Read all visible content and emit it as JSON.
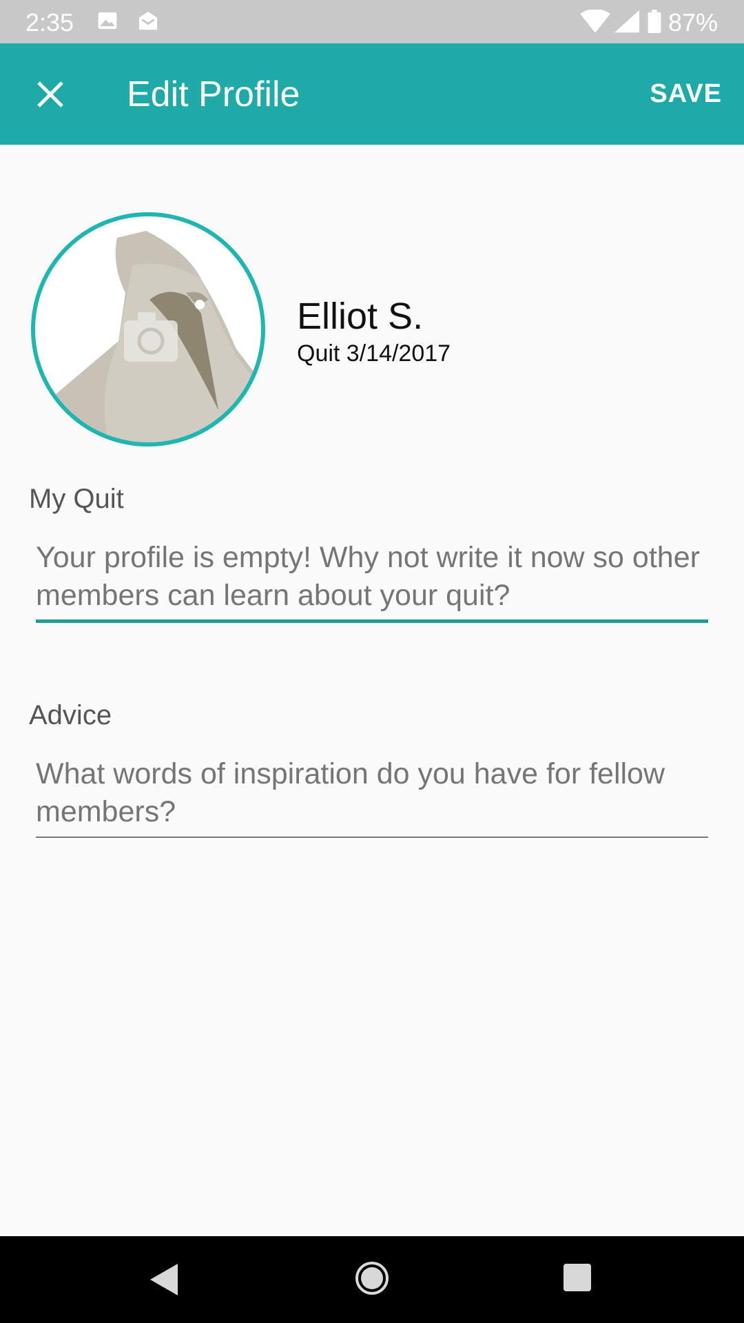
{
  "status_bar": {
    "time": "2:35",
    "battery": "87%",
    "icons": [
      "image-icon",
      "mail-icon",
      "wifi-icon",
      "signal-icon",
      "battery-icon"
    ]
  },
  "app_bar": {
    "title": "Edit Profile",
    "save_label": "SAVE",
    "close_icon": "close-icon",
    "color": "#1fa9a7"
  },
  "profile": {
    "name": "Elliot S.",
    "quit_date": "Quit 3/14/2017",
    "avatar_icon": "bird-avatar-camera-icon",
    "accent": "#1fb5b1"
  },
  "my_quit": {
    "label": "My Quit",
    "placeholder": "Your profile is empty! Why not write it now so other members can learn about your quit?",
    "value": ""
  },
  "advice": {
    "label": "Advice",
    "placeholder": "What words of inspiration do you have for fellow members?",
    "value": ""
  },
  "nav_bar": {
    "icons": [
      "back-icon",
      "home-icon",
      "recents-icon"
    ]
  }
}
